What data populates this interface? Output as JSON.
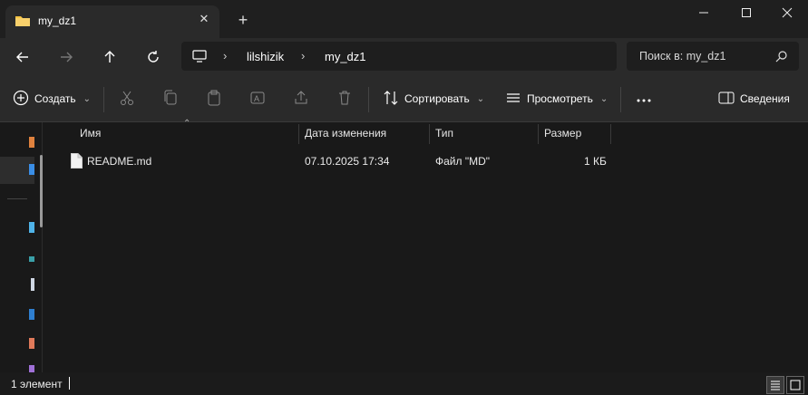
{
  "tab": {
    "title": "my_dz1"
  },
  "address": {
    "crumbs": [
      "lilshizik",
      "my_dz1"
    ]
  },
  "search": {
    "placeholder": "Поиск в: my_dz1"
  },
  "toolbar": {
    "create_label": "Создать",
    "sort_label": "Сортировать",
    "view_label": "Просмотреть",
    "details_label": "Сведения"
  },
  "columns": [
    "Имя",
    "Дата изменения",
    "Тип",
    "Размер"
  ],
  "files": [
    {
      "name": "README.md",
      "modified": "07.10.2025 17:34",
      "type": "Файл \"MD\"",
      "size": "1 КБ"
    }
  ],
  "status": {
    "count": "1 элемент"
  },
  "colors": {
    "accent": "#0078d4",
    "folder": "#f6c443"
  },
  "icons": [
    "folder-icon",
    "close-icon",
    "plus-icon",
    "minimize-icon",
    "maximize-icon",
    "back-icon",
    "forward-icon",
    "up-icon",
    "refresh-icon",
    "computer-icon",
    "search-icon",
    "create-icon",
    "cut-icon",
    "copy-icon",
    "paste-icon",
    "rename-icon",
    "share-icon",
    "delete-icon",
    "sort-icon",
    "view-icon",
    "more-icon",
    "details-icon",
    "file-icon"
  ]
}
